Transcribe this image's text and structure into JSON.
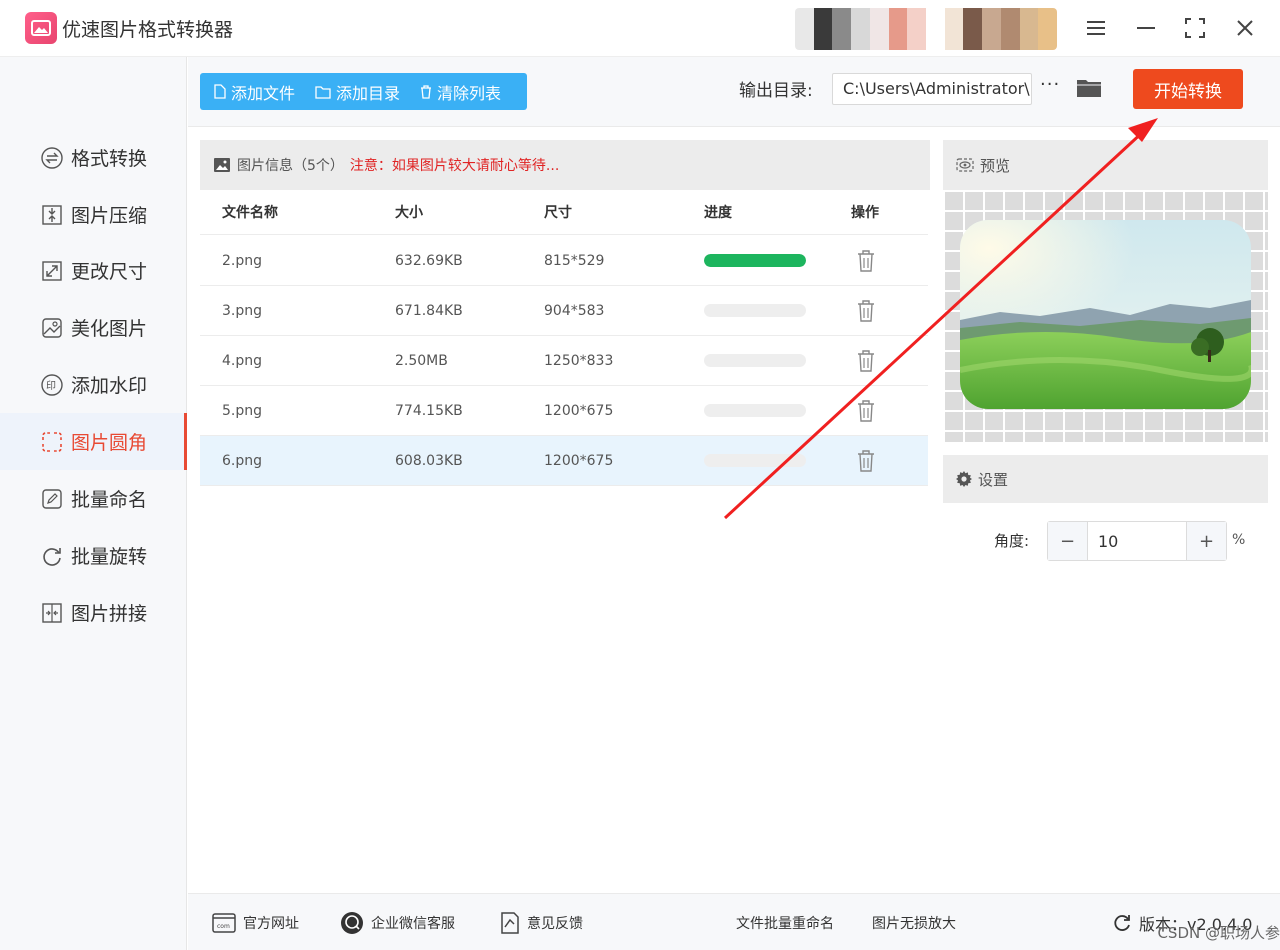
{
  "app": {
    "title": "优速图片格式转换器"
  },
  "colors": {
    "accent": "#e84a34",
    "toolbar_blue": "#3ab0f5",
    "start_button": "#ee4a1e",
    "progress_green": "#1db55e",
    "notice_red": "#e02424"
  },
  "sidebar": {
    "items": [
      {
        "label": "格式转换",
        "icon": "swap-circle-icon"
      },
      {
        "label": "图片压缩",
        "icon": "compress-icon"
      },
      {
        "label": "更改尺寸",
        "icon": "resize-icon"
      },
      {
        "label": "美化图片",
        "icon": "beautify-icon"
      },
      {
        "label": "添加水印",
        "icon": "watermark-icon"
      },
      {
        "label": "图片圆角",
        "icon": "rounded-corner-icon",
        "active": true
      },
      {
        "label": "批量命名",
        "icon": "rename-icon"
      },
      {
        "label": "批量旋转",
        "icon": "rotate-icon"
      },
      {
        "label": "图片拼接",
        "icon": "splice-icon"
      }
    ]
  },
  "toolbar": {
    "add_file": "添加文件",
    "add_folder": "添加目录",
    "clear_list": "清除列表",
    "output_label": "输出目录:",
    "output_path": "C:\\Users\\Administrator\\",
    "more": "···",
    "start": "开始转换"
  },
  "file_panel": {
    "title": "图片信息（5个）",
    "notice": "注意：如果图片较大请耐心等待...",
    "columns": [
      "文件名称",
      "大小",
      "尺寸",
      "进度",
      "操作"
    ],
    "rows": [
      {
        "name": "2.png",
        "size": "632.69KB",
        "dims": "815*529",
        "progress": 1.0
      },
      {
        "name": "3.png",
        "size": "671.84KB",
        "dims": "904*583",
        "progress": 0
      },
      {
        "name": "4.png",
        "size": "2.50MB",
        "dims": "1250*833",
        "progress": 0
      },
      {
        "name": "5.png",
        "size": "774.15KB",
        "dims": "1200*675",
        "progress": 0
      },
      {
        "name": "6.png",
        "size": "608.03KB",
        "dims": "1200*675",
        "progress": 0,
        "selected": true
      }
    ]
  },
  "preview": {
    "title": "预览"
  },
  "settings": {
    "title": "设置",
    "angle_label": "角度:",
    "angle_value": "10",
    "unit": "%",
    "minus": "−",
    "plus": "+"
  },
  "footer": {
    "website": "官方网址",
    "wechat": "企业微信客服",
    "feedback": "意见反馈",
    "batch_rename": "文件批量重命名",
    "lossless": "图片无损放大",
    "version": "版本：v2.0.4.0",
    "watermark": "CSDN @职场人参"
  }
}
